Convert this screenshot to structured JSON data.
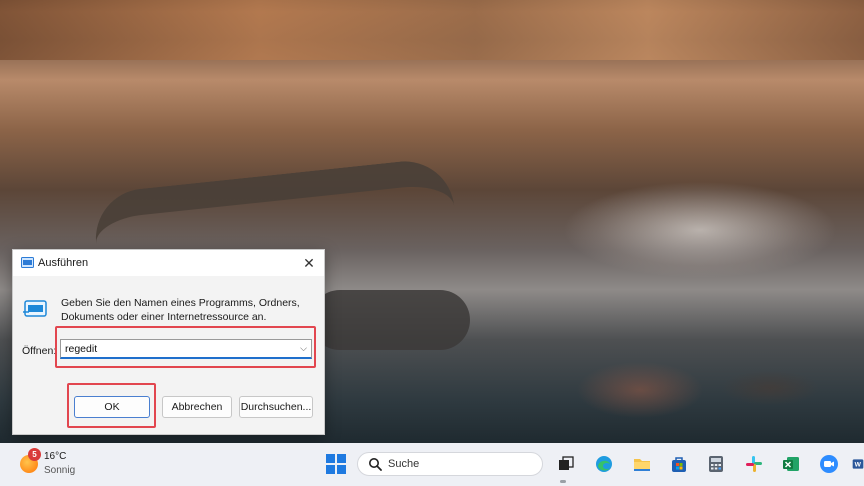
{
  "dialog": {
    "title": "Ausführen",
    "description": "Geben Sie den Namen eines Programms, Ordners, Dokuments oder einer Internetressource an.",
    "open_label": "Öffnen:",
    "open_value": "regedit",
    "buttons": {
      "ok": "OK",
      "cancel": "Abbrechen",
      "browse": "Durchsuchen..."
    },
    "highlight_color": "#e2464f"
  },
  "taskbar": {
    "weather": {
      "badge": "5",
      "temperature": "16°C",
      "condition": "Sonnig"
    },
    "search_placeholder": "Suche",
    "apps": [
      "start-icon",
      "task-view-icon",
      "edge-icon",
      "file-explorer-icon",
      "store-icon",
      "calculator-icon",
      "slack-icon",
      "excel-icon",
      "zoom-icon",
      "word-icon"
    ]
  },
  "colors": {
    "accent": "#1f7ae0",
    "taskbar_bg": "#eef0f5"
  }
}
